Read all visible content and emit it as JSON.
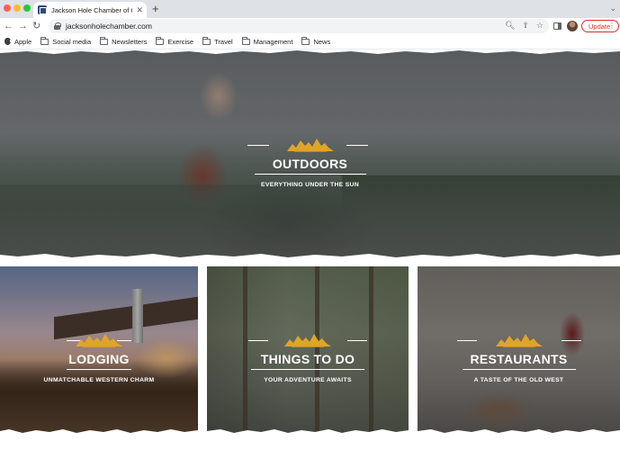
{
  "browser": {
    "tab_title": "Jackson Hole Chamber of Com",
    "url": "jacksonholechamber.com",
    "update_label": "Update",
    "bookmarks": [
      "Apple",
      "Social media",
      "Newsletters",
      "Exercise",
      "Travel",
      "Management",
      "News"
    ]
  },
  "hero": {
    "title": "OUTDOORS",
    "subtitle": "EVERYTHING UNDER THE SUN"
  },
  "cards": [
    {
      "title": "LODGING",
      "subtitle": "UNMATCHABLE WESTERN CHARM"
    },
    {
      "title": "THINGS TO DO",
      "subtitle": "YOUR ADVENTURE AWAITS"
    },
    {
      "title": "RESTAURANTS",
      "subtitle": "A TASTE OF THE OLD WEST"
    }
  ],
  "colors": {
    "logo_gold": "#e0a526",
    "update_red": "#d93025"
  }
}
